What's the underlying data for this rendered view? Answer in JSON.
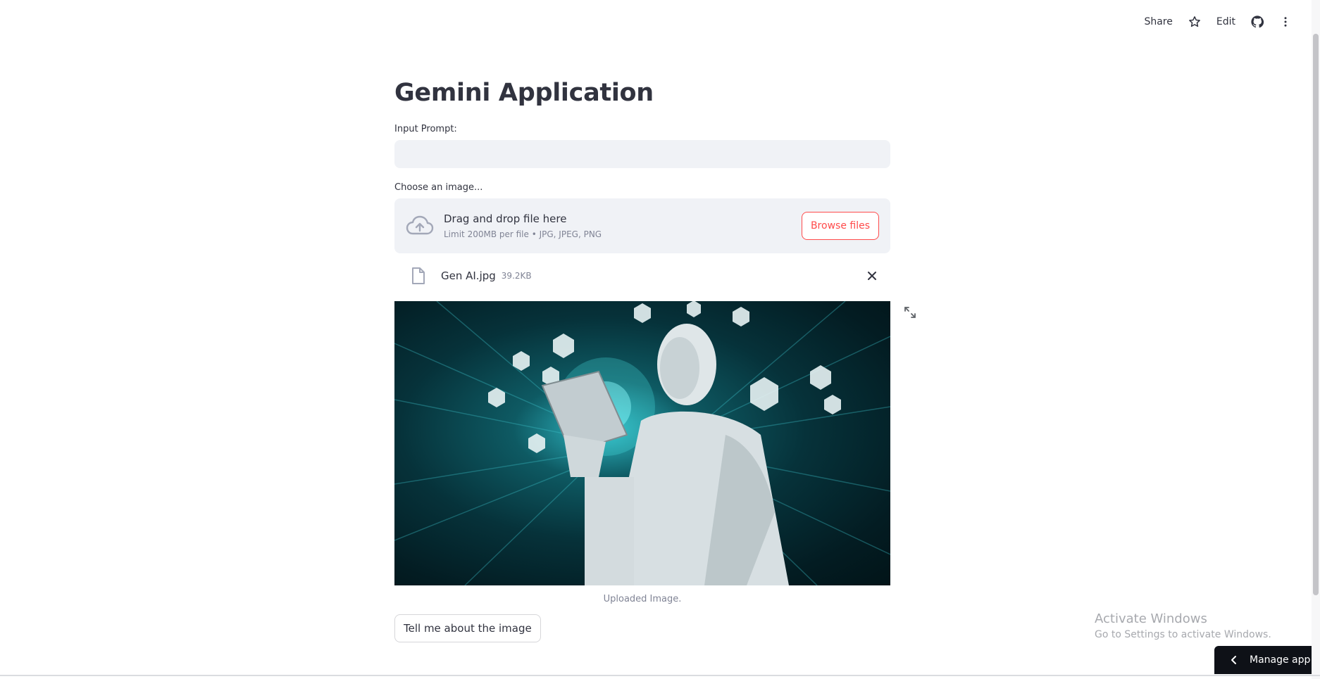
{
  "toolbar": {
    "share_label": "Share",
    "edit_label": "Edit",
    "icons": [
      "star-icon",
      "github-icon",
      "more-vertical-icon"
    ]
  },
  "main": {
    "title": "Gemini Application",
    "prompt_label": "Input Prompt:",
    "prompt_value": "",
    "uploader_label": "Choose an image...",
    "dropzone_title": "Drag and drop file here",
    "dropzone_sub": "Limit 200MB per file • JPG, JPEG, PNG",
    "browse_label": "Browse files",
    "file_name": "Gen AI.jpg",
    "file_size": "39.2KB",
    "image_caption": "Uploaded Image.",
    "action_label": "Tell me about the image"
  },
  "watermark": {
    "title": "Activate Windows",
    "subtitle": "Go to Settings to activate Windows."
  },
  "manage_app_label": "Manage app",
  "colors": {
    "accent": "#ff4b4b",
    "input_bg": "#f0f2f6",
    "text": "#31333f",
    "muted": "#808495",
    "dark": "#0e1117"
  }
}
